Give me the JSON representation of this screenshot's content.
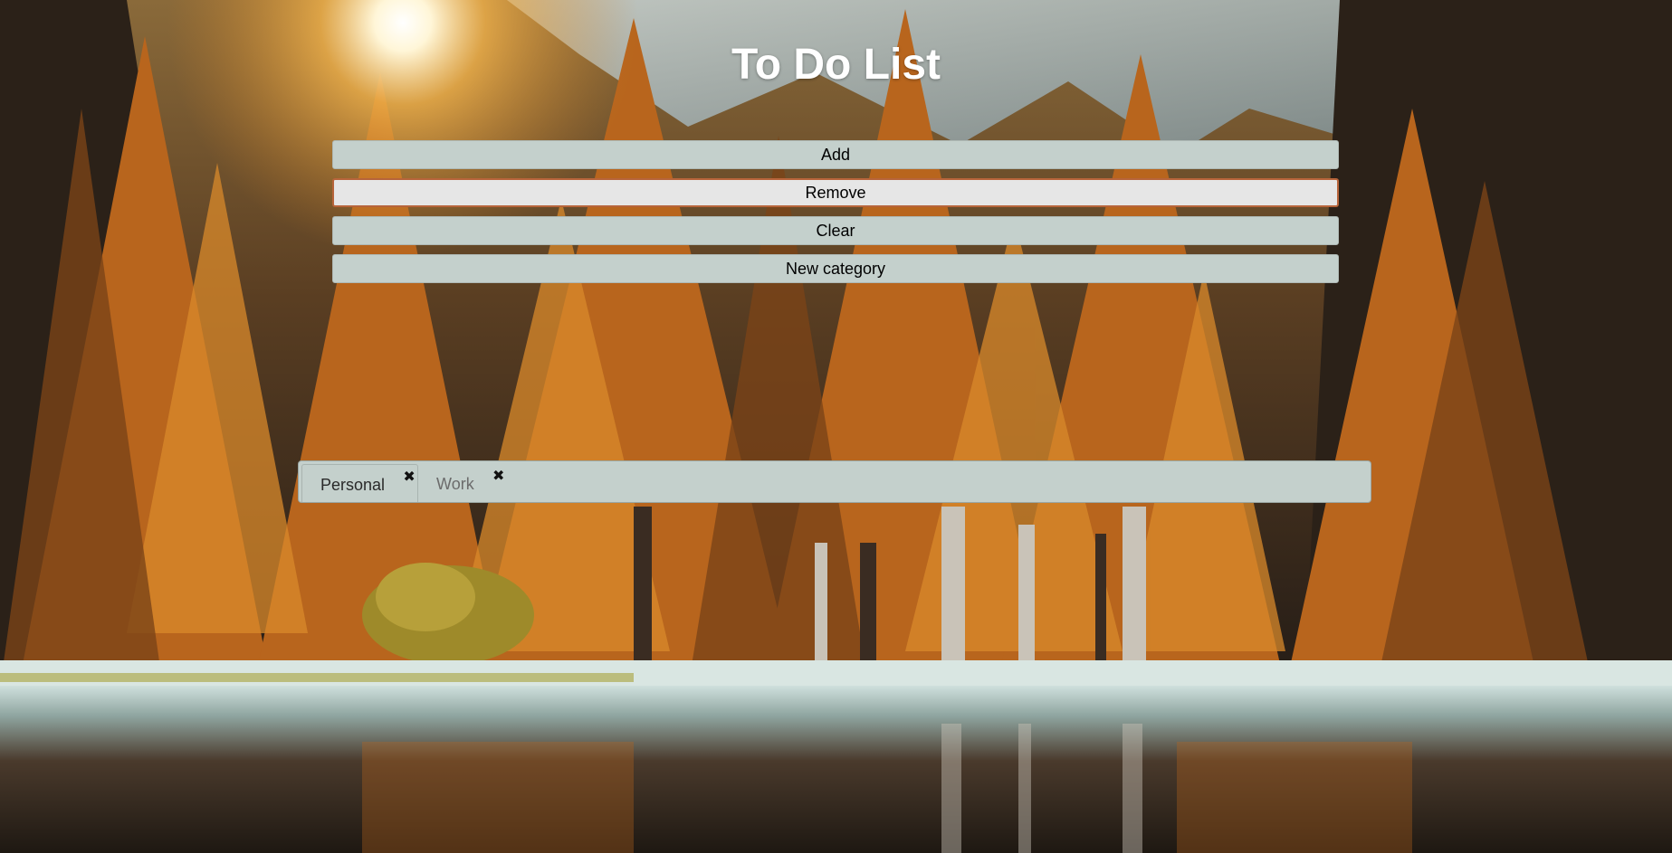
{
  "header": {
    "title": "To Do List"
  },
  "actions": {
    "add_label": "Add",
    "remove_label": "Remove",
    "clear_label": "Clear",
    "new_category_label": "New category"
  },
  "categories": {
    "tabs": [
      {
        "label": "Personal",
        "active": true,
        "close_icon": "close-icon"
      },
      {
        "label": "Work",
        "active": false,
        "close_icon": "close-icon"
      }
    ]
  },
  "theme": {
    "control_background": "#c4d0cc",
    "focus_border": "#b7643a",
    "title_color": "#ffffff"
  }
}
